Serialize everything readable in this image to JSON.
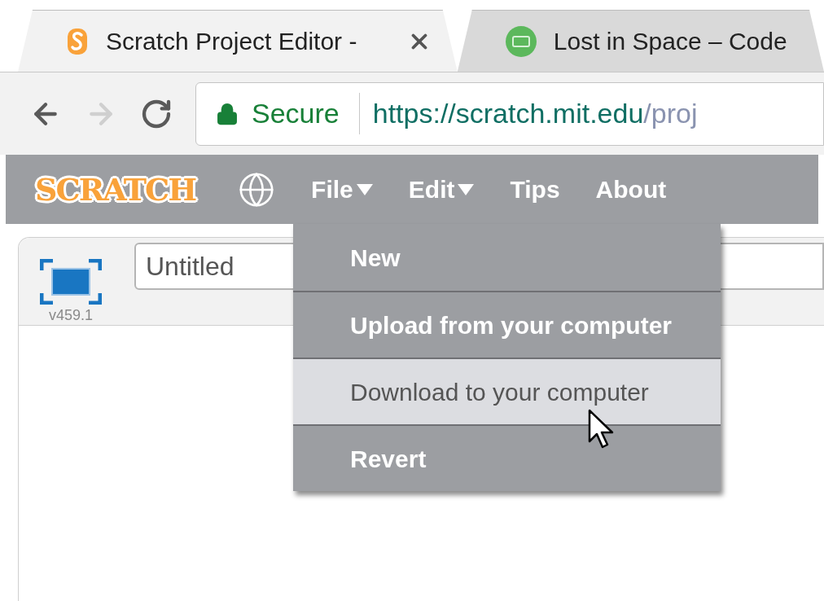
{
  "browser": {
    "tabs": [
      {
        "title": "Scratch Project Editor -",
        "selected": true,
        "kind": "scratch"
      },
      {
        "title": "Lost in Space – Code",
        "selected": false,
        "kind": "codeclub"
      }
    ],
    "nav_buttons": [
      {
        "kind": "back",
        "disabled": false
      },
      {
        "kind": "forward",
        "disabled": true
      },
      {
        "kind": "reload",
        "disabled": false
      }
    ],
    "address": {
      "security": "Secure",
      "url_host": "https://scratch.mit.edu",
      "url_path": "/proj"
    }
  },
  "scratch": {
    "logo": "SCRATCH",
    "menu": [
      {
        "label": "File",
        "has_dropdown": true
      },
      {
        "label": "Edit",
        "has_dropdown": true
      },
      {
        "label": "Tips",
        "has_dropdown": false
      },
      {
        "label": "About",
        "has_dropdown": false
      }
    ],
    "project": {
      "title": "Untitled",
      "version": "v459.1"
    },
    "file_menu": {
      "items": [
        {
          "label": "New",
          "selected": false
        },
        {
          "label": "Upload from your computer",
          "selected": false
        },
        {
          "label": "Download to your computer",
          "selected": true
        },
        {
          "label": "Revert",
          "selected": false
        }
      ]
    }
  }
}
